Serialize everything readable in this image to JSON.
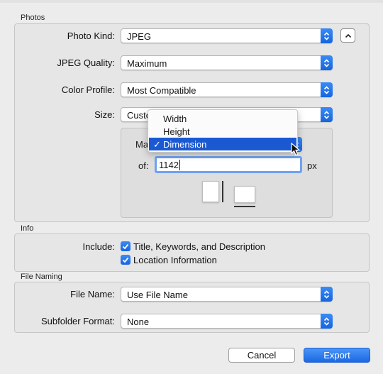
{
  "photos": {
    "section_title": "Photos",
    "photo_kind_label": "Photo Kind:",
    "photo_kind_value": "JPEG",
    "jpeg_quality_label": "JPEG Quality:",
    "jpeg_quality_value": "Maximum",
    "color_profile_label": "Color Profile:",
    "color_profile_value": "Most Compatible",
    "size_label": "Size:",
    "size_value": "Custo",
    "max_label": "Ma",
    "of_label": "of:",
    "dimension_value": "1142",
    "unit_label": "px"
  },
  "dimension_menu": {
    "items": [
      "Width",
      "Height",
      "Dimension"
    ],
    "selected_index": 2,
    "check_mark": "✓"
  },
  "info": {
    "section_title": "Info",
    "include_label": "Include:",
    "checkbox_title": "Title, Keywords, and Description",
    "checkbox_location": "Location Information",
    "checkbox_title_checked": true,
    "checkbox_location_checked": true
  },
  "file_naming": {
    "section_title": "File Naming",
    "file_name_label": "File Name:",
    "file_name_value": "Use File Name",
    "subfolder_label": "Subfolder Format:",
    "subfolder_value": "None"
  },
  "buttons": {
    "cancel": "Cancel",
    "export": "Export"
  },
  "colors": {
    "accent": "#1b59d3",
    "background": "#ececec"
  },
  "icons": {
    "popup_stepper": "up-down-chevron-icon",
    "collapse": "chevron-up-icon",
    "orientation_portrait": "portrait-orientation-icon",
    "orientation_landscape": "landscape-orientation-icon",
    "cursor": "mouse-pointer-icon"
  }
}
